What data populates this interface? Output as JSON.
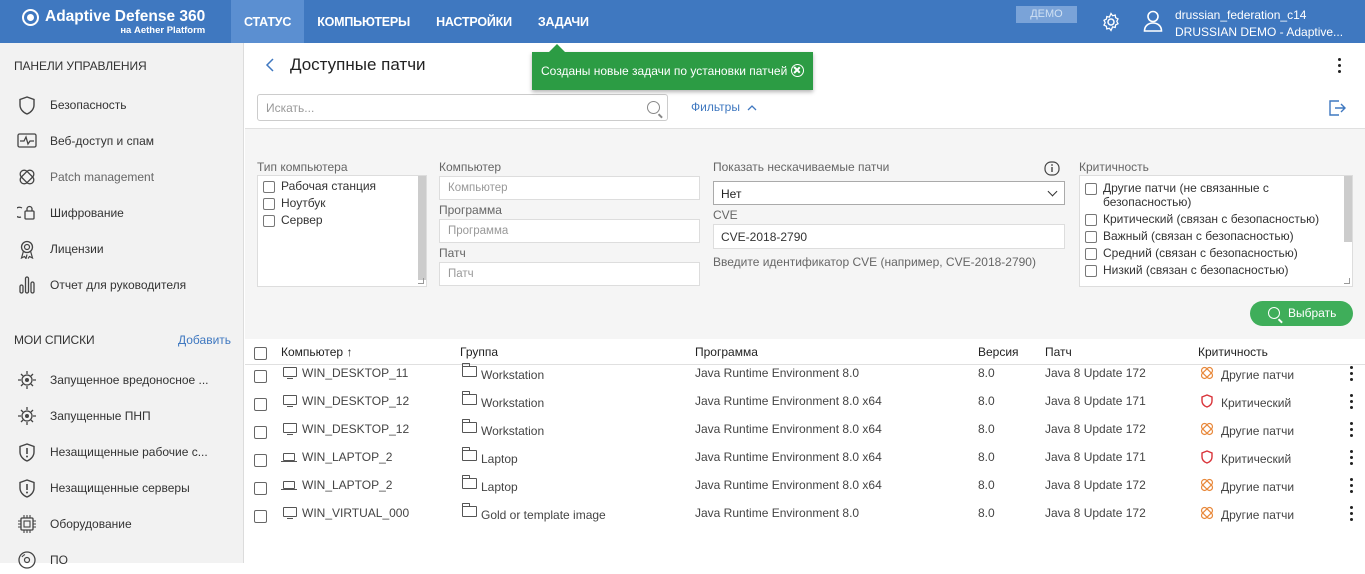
{
  "app": {
    "brand": "Adaptive Defense 360",
    "sub": "на Aether Platform"
  },
  "nav": [
    {
      "label": "СТАТУС"
    },
    {
      "label": "КОМПЬЮТЕРЫ"
    },
    {
      "label": "НАСТРОЙКИ"
    },
    {
      "label": "ЗАДАЧИ"
    }
  ],
  "demo": "ДЕМО",
  "user": {
    "name": "drussian_federation_c14",
    "org": "DRUSSIAN DEMO - Adaptive..."
  },
  "sidebar": {
    "section1": "ПАНЕЛИ УПРАВЛЕНИЯ",
    "items1": [
      {
        "label": "Безопасность",
        "icon": "shield-icon"
      },
      {
        "label": "Веб-доступ и спам",
        "icon": "pulse-icon"
      },
      {
        "label": "Patch management",
        "icon": "patch-icon"
      },
      {
        "label": "Шифрование",
        "icon": "encryption-icon"
      },
      {
        "label": "Лицензии",
        "icon": "license-icon"
      },
      {
        "label": "Отчет для руководителя",
        "icon": "bar-chart-icon"
      }
    ],
    "section2": "МОИ СПИСКИ",
    "add": "Добавить",
    "items2": [
      {
        "label": "Запущенное вредоносное ...",
        "icon": "malware-icon"
      },
      {
        "label": "Запущенные ПНП",
        "icon": "pup-icon"
      },
      {
        "label": "Незащищенные рабочие с...",
        "icon": "alert-shield-icon"
      },
      {
        "label": "Незащищенные серверы",
        "icon": "alert-shield-icon"
      },
      {
        "label": "Оборудование",
        "icon": "chip-icon"
      },
      {
        "label": "ПО",
        "icon": "software-icon"
      }
    ]
  },
  "page": {
    "title": "Доступные патчи"
  },
  "toast": "Созданы новые задачи по установки патчей",
  "search": {
    "placeholder": "Искать..."
  },
  "filters_label": "Фильтры",
  "filter": {
    "type_label": "Тип компьютера",
    "types": [
      "Рабочая станция",
      "Ноутбук",
      "Сервер"
    ],
    "computer_label": "Компьютер",
    "computer_ph": "Компьютер",
    "program_label": "Программа",
    "program_ph": "Программа",
    "patch_label": "Патч",
    "patch_ph": "Патч",
    "nondl_label": "Показать нескачиваемые патчи",
    "nondl_value": "Нет",
    "cve_label": "CVE",
    "cve_value": "CVE-2018-2790",
    "cve_hint": "Введите идентификатор CVE (например, CVE-2018-2790)",
    "crit_label": "Критичность",
    "crits": [
      "Другие патчи (не связанные с безопасностью)",
      "Критический (связан с безопасностью)",
      "Важный (связан с безопасностью)",
      "Средний (связан с безопасностью)",
      "Низкий (связан с безопасностью)"
    ],
    "select_btn": "Выбрать"
  },
  "table": {
    "headers": {
      "computer": "Компьютер ↑",
      "group": "Группа",
      "program": "Программа",
      "version": "Версия",
      "patch": "Патч",
      "crit": "Критичность"
    },
    "rows": [
      {
        "computer": "WIN_DESKTOP_11",
        "device": "desktop",
        "group": "Workstation",
        "program": "Java Runtime Environment 8.0",
        "version": "8.0",
        "patch": "Java 8 Update 172",
        "crit": "Другие патчи",
        "crit_kind": "other"
      },
      {
        "computer": "WIN_DESKTOP_12",
        "device": "desktop",
        "group": "Workstation",
        "program": "Java Runtime Environment 8.0 x64",
        "version": "8.0",
        "patch": "Java 8 Update 171",
        "crit": "Критический",
        "crit_kind": "critical"
      },
      {
        "computer": "WIN_DESKTOP_12",
        "device": "desktop",
        "group": "Workstation",
        "program": "Java Runtime Environment 8.0 x64",
        "version": "8.0",
        "patch": "Java 8 Update 172",
        "crit": "Другие патчи",
        "crit_kind": "other"
      },
      {
        "computer": "WIN_LAPTOP_2",
        "device": "laptop",
        "group": "Laptop",
        "program": "Java Runtime Environment 8.0 x64",
        "version": "8.0",
        "patch": "Java 8 Update 171",
        "crit": "Критический",
        "crit_kind": "critical"
      },
      {
        "computer": "WIN_LAPTOP_2",
        "device": "laptop",
        "group": "Laptop",
        "program": "Java Runtime Environment 8.0 x64",
        "version": "8.0",
        "patch": "Java 8 Update 172",
        "crit": "Другие патчи",
        "crit_kind": "other"
      },
      {
        "computer": "WIN_VIRTUAL_000",
        "device": "desktop",
        "group": "Gold or template image",
        "program": "Java Runtime Environment 8.0",
        "version": "8.0",
        "patch": "Java 8 Update 172",
        "crit": "Другие патчи",
        "crit_kind": "other"
      }
    ]
  },
  "colors": {
    "topbar": "#3f78c0",
    "nav_active": "#5b8fd1",
    "toast": "#2c9c44",
    "accent": "#3f78c0",
    "critical": "#d9343a",
    "other": "#e8883a"
  }
}
